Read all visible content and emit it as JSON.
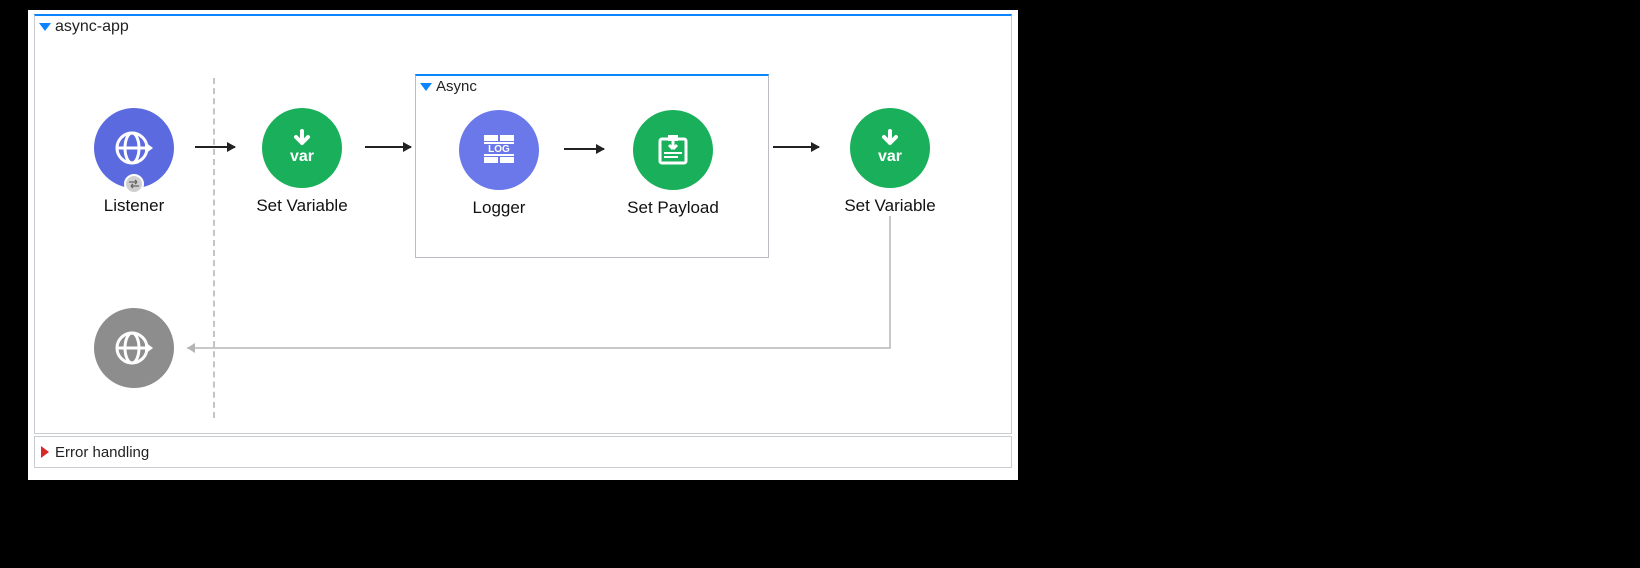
{
  "flow": {
    "name": "async-app",
    "scope_name": "Async",
    "nodes": {
      "listener": {
        "label": "Listener",
        "icon": "http-listener-icon",
        "color": "blue"
      },
      "set_var_1": {
        "label": "Set Variable",
        "icon": "set-variable-icon",
        "color": "green"
      },
      "logger": {
        "label": "Logger",
        "icon": "logger-icon",
        "color": "blue"
      },
      "set_payload": {
        "label": "Set Payload",
        "icon": "set-payload-icon",
        "color": "green"
      },
      "set_var_2": {
        "label": "Set Variable",
        "icon": "set-variable-icon",
        "color": "green"
      },
      "response": {
        "label": "",
        "icon": "http-response-icon",
        "color": "grey"
      }
    }
  },
  "error_panel": {
    "title": "Error handling"
  },
  "icons": {
    "http-listener-icon": "globe-arrow",
    "set-variable-icon": "down-arrow-var",
    "logger-icon": "log-bricks",
    "set-payload-icon": "clipboard-down",
    "http-response-icon": "globe-arrow",
    "exchange-icon": "exchange"
  },
  "colors": {
    "blue": "#5c6ae0",
    "green": "#1ab05b",
    "grey": "#8d8d8d",
    "accent_border": "#0a84ff",
    "error_accent": "#d92828"
  }
}
